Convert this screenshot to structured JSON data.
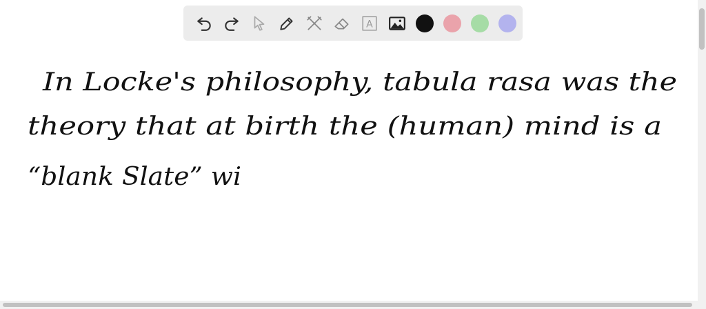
{
  "toolbar": {
    "tools": [
      {
        "name": "undo",
        "icon": "undo-icon"
      },
      {
        "name": "redo",
        "icon": "redo-icon"
      },
      {
        "name": "select",
        "icon": "cursor-icon"
      },
      {
        "name": "pen",
        "icon": "pen-icon"
      },
      {
        "name": "tools",
        "icon": "tools-icon"
      },
      {
        "name": "eraser",
        "icon": "eraser-icon"
      },
      {
        "name": "text",
        "icon": "text-box-icon",
        "label": "A"
      },
      {
        "name": "image",
        "icon": "image-icon"
      }
    ],
    "colors": [
      "#111111",
      "#eaa3ab",
      "#a6dca6",
      "#b3b3ee"
    ],
    "selected_color": "#111111"
  },
  "canvas": {
    "lines": [
      "In Locke's philosophy, tabula rasa was the",
      "theory that at birth the (human) mind is a",
      "“blank Slate” wi"
    ]
  }
}
